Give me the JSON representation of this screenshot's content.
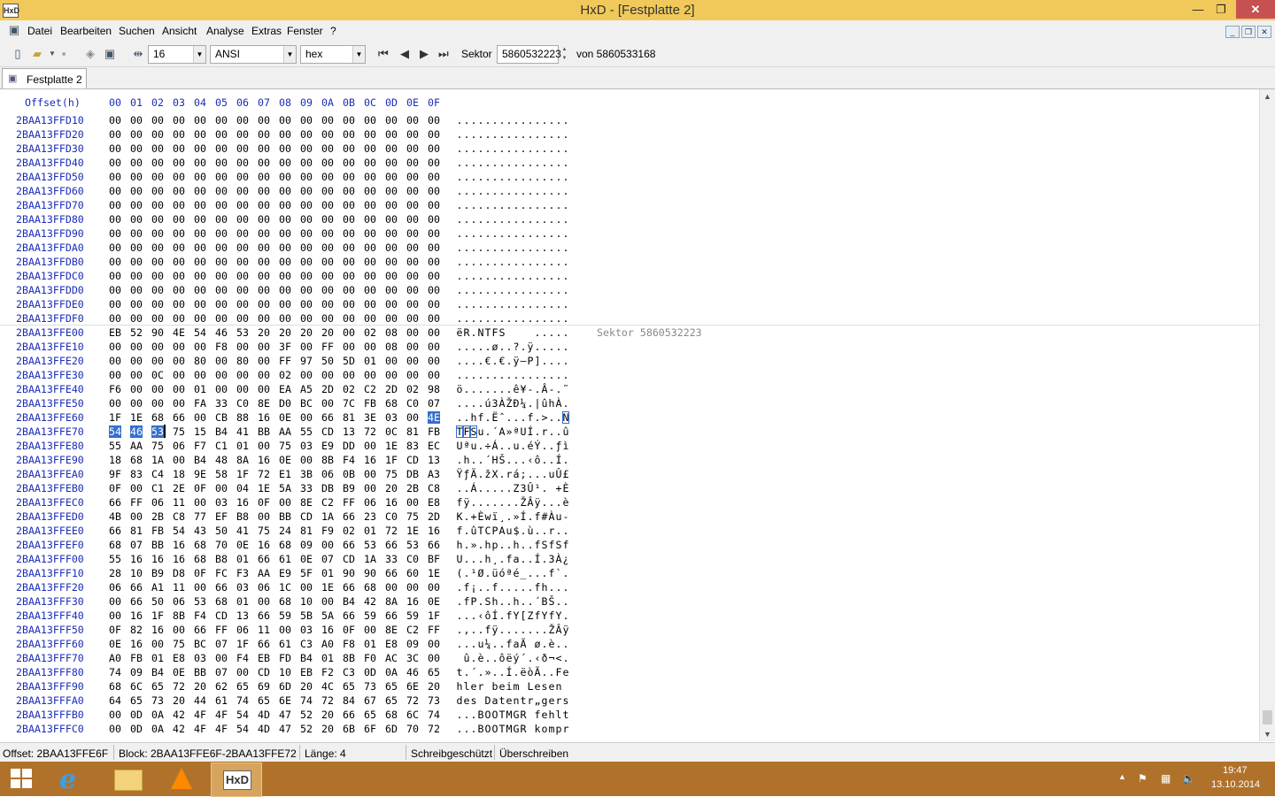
{
  "window": {
    "title": "HxD - [Festplatte 2]",
    "icon_text": "HxD"
  },
  "menu": [
    "Datei",
    "Bearbeiten",
    "Suchen",
    "Ansicht",
    "Analyse",
    "Extras",
    "Fenster",
    "?"
  ],
  "toolbar": {
    "bytes_per_row": "16",
    "charset": "ANSI",
    "offset_base": "hex",
    "sektor_label": "Sektor",
    "sektor_value": "5860532223",
    "sektor_total": "von 5860533168"
  },
  "tab": {
    "label": "Festplatte 2"
  },
  "editor": {
    "offset_header": "Offset(h)",
    "col_headers": [
      "00",
      "01",
      "02",
      "03",
      "04",
      "05",
      "06",
      "07",
      "08",
      "09",
      "0A",
      "0B",
      "0C",
      "0D",
      "0E",
      "0F"
    ],
    "sector_note": "Sektor 5860532223",
    "rows": [
      {
        "o": "2BAA13FFD10",
        "h": "00 00 00 00 00 00 00 00 00 00 00 00 00 00 00 00",
        "a": "................"
      },
      {
        "o": "2BAA13FFD20",
        "h": "00 00 00 00 00 00 00 00 00 00 00 00 00 00 00 00",
        "a": "................"
      },
      {
        "o": "2BAA13FFD30",
        "h": "00 00 00 00 00 00 00 00 00 00 00 00 00 00 00 00",
        "a": "................"
      },
      {
        "o": "2BAA13FFD40",
        "h": "00 00 00 00 00 00 00 00 00 00 00 00 00 00 00 00",
        "a": "................"
      },
      {
        "o": "2BAA13FFD50",
        "h": "00 00 00 00 00 00 00 00 00 00 00 00 00 00 00 00",
        "a": "................"
      },
      {
        "o": "2BAA13FFD60",
        "h": "00 00 00 00 00 00 00 00 00 00 00 00 00 00 00 00",
        "a": "................"
      },
      {
        "o": "2BAA13FFD70",
        "h": "00 00 00 00 00 00 00 00 00 00 00 00 00 00 00 00",
        "a": "................"
      },
      {
        "o": "2BAA13FFD80",
        "h": "00 00 00 00 00 00 00 00 00 00 00 00 00 00 00 00",
        "a": "................"
      },
      {
        "o": "2BAA13FFD90",
        "h": "00 00 00 00 00 00 00 00 00 00 00 00 00 00 00 00",
        "a": "................"
      },
      {
        "o": "2BAA13FFDA0",
        "h": "00 00 00 00 00 00 00 00 00 00 00 00 00 00 00 00",
        "a": "................"
      },
      {
        "o": "2BAA13FFDB0",
        "h": "00 00 00 00 00 00 00 00 00 00 00 00 00 00 00 00",
        "a": "................"
      },
      {
        "o": "2BAA13FFDC0",
        "h": "00 00 00 00 00 00 00 00 00 00 00 00 00 00 00 00",
        "a": "................"
      },
      {
        "o": "2BAA13FFDD0",
        "h": "00 00 00 00 00 00 00 00 00 00 00 00 00 00 00 00",
        "a": "................"
      },
      {
        "o": "2BAA13FFDE0",
        "h": "00 00 00 00 00 00 00 00 00 00 00 00 00 00 00 00",
        "a": "................"
      },
      {
        "o": "2BAA13FFDF0",
        "h": "00 00 00 00 00 00 00 00 00 00 00 00 00 00 00 00",
        "a": "................"
      },
      {
        "o": "2BAA13FFE00",
        "h": "EB 52 90 4E 54 46 53 20 20 20 20 00 02 08 00 00",
        "a": "ëR.NTFS    ....."
      },
      {
        "o": "2BAA13FFE10",
        "h": "00 00 00 00 00 F8 00 00 3F 00 FF 00 00 08 00 00",
        "a": ".....ø..?.ÿ....."
      },
      {
        "o": "2BAA13FFE20",
        "h": "00 00 00 00 80 00 80 00 FF 97 50 5D 01 00 00 00",
        "a": "....€.€.ÿ—P]...."
      },
      {
        "o": "2BAA13FFE30",
        "h": "00 00 0C 00 00 00 00 00 02 00 00 00 00 00 00 00",
        "a": "................"
      },
      {
        "o": "2BAA13FFE40",
        "h": "F6 00 00 00 01 00 00 00 EA A5 2D 02 C2 2D 02 98",
        "a": "ö.......ê¥-.Â-.˜"
      },
      {
        "o": "2BAA13FFE50",
        "h": "00 00 00 00 FA 33 C0 8E D0 BC 00 7C FB 68 C0 07",
        "a": "....ú3ÀŽÐ¼.|ûhÀ."
      },
      {
        "o": "2BAA13FFE60",
        "h": "1F 1E 68 66 00 CB 88 16 0E 00 66 81 3E 03 00 4E",
        "a": "..hf.Ëˆ...f.>..N"
      },
      {
        "o": "2BAA13FFE70",
        "h": "54 46 53 75 15 B4 41 BB AA 55 CD 13 72 0C 81 FB",
        "a": "TFSu.´A»ªUÍ.r..û"
      },
      {
        "o": "2BAA13FFE80",
        "h": "55 AA 75 06 F7 C1 01 00 75 03 E9 DD 00 1E 83 EC",
        "a": "Uªu.÷Á..u.éÝ..ƒì"
      },
      {
        "o": "2BAA13FFE90",
        "h": "18 68 1A 00 B4 48 8A 16 0E 00 8B F4 16 1F CD 13",
        "a": ".h..´HŠ...‹ô..Í."
      },
      {
        "o": "2BAA13FFEA0",
        "h": "9F 83 C4 18 9E 58 1F 72 E1 3B 06 0B 00 75 DB A3",
        "a": "ŸƒÄ.žX.rá;...uÛ£"
      },
      {
        "o": "2BAA13FFEB0",
        "h": "0F 00 C1 2E 0F 00 04 1E 5A 33 DB B9 00 20 2B C8",
        "a": "..Á.....Z3Û¹. +È"
      },
      {
        "o": "2BAA13FFEC0",
        "h": "66 FF 06 11 00 03 16 0F 00 8E C2 FF 06 16 00 E8",
        "a": "fÿ.......ŽÂÿ...è"
      },
      {
        "o": "2BAA13FFED0",
        "h": "4B 00 2B C8 77 EF B8 00 BB CD 1A 66 23 C0 75 2D",
        "a": "K.+Èwï¸.»Í.f#Àu-"
      },
      {
        "o": "2BAA13FFEE0",
        "h": "66 81 FB 54 43 50 41 75 24 81 F9 02 01 72 1E 16",
        "a": "f.ûTCPAu$.ù..r.."
      },
      {
        "o": "2BAA13FFEF0",
        "h": "68 07 BB 16 68 70 0E 16 68 09 00 66 53 66 53 66",
        "a": "h.».hp..h..fSfSf"
      },
      {
        "o": "2BAA13FFF00",
        "h": "55 16 16 16 68 B8 01 66 61 0E 07 CD 1A 33 C0 BF",
        "a": "U...h¸.fa..Í.3À¿"
      },
      {
        "o": "2BAA13FFF10",
        "h": "28 10 B9 D8 0F FC F3 AA E9 5F 01 90 90 66 60 1E",
        "a": "(.¹Ø.üóªé_...f`."
      },
      {
        "o": "2BAA13FFF20",
        "h": "06 66 A1 11 00 66 03 06 1C 00 1E 66 68 00 00 00",
        "a": ".f¡..f.....fh..."
      },
      {
        "o": "2BAA13FFF30",
        "h": "00 66 50 06 53 68 01 00 68 10 00 B4 42 8A 16 0E",
        "a": ".fP.Sh..h..´BŠ.."
      },
      {
        "o": "2BAA13FFF40",
        "h": "00 16 1F 8B F4 CD 13 66 59 5B 5A 66 59 66 59 1F",
        "a": "...‹ôÍ.fY[ZfYfY."
      },
      {
        "o": "2BAA13FFF50",
        "h": "0F 82 16 00 66 FF 06 11 00 03 16 0F 00 8E C2 FF",
        "a": ".‚..fÿ.......ŽÂÿ"
      },
      {
        "o": "2BAA13FFF60",
        "h": "0E 16 00 75 BC 07 1F 66 61 C3 A0 F8 01 E8 09 00",
        "a": "...u¼..faÃ ø.è.."
      },
      {
        "o": "2BAA13FFF70",
        "h": "A0 FB 01 E8 03 00 F4 EB FD B4 01 8B F0 AC 3C 00",
        "a": " û.è..ôëý´.‹ð¬<."
      },
      {
        "o": "2BAA13FFF80",
        "h": "74 09 B4 0E BB 07 00 CD 10 EB F2 C3 0D 0A 46 65",
        "a": "t.´.»..Í.ëòÃ..Fe"
      },
      {
        "o": "2BAA13FFF90",
        "h": "68 6C 65 72 20 62 65 69 6D 20 4C 65 73 65 6E 20",
        "a": "hler beim Lesen "
      },
      {
        "o": "2BAA13FFFA0",
        "h": "64 65 73 20 44 61 74 65 6E 74 72 84 67 65 72 73",
        "a": "des Datentr„gers"
      },
      {
        "o": "2BAA13FFFB0",
        "h": "00 0D 0A 42 4F 4F 54 4D 47 52 20 66 65 68 6C 74",
        "a": "...BOOTMGR fehlt"
      },
      {
        "o": "2BAA13FFFC0",
        "h": "00 0D 0A 42 4F 4F 54 4D 47 52 20 6B 6F 6D 70 72",
        "a": "...BOOTMGR kompr"
      }
    ]
  },
  "status": {
    "offset": "Offset: 2BAA13FFE6F",
    "block": "Block: 2BAA13FFE6F-2BAA13FFE72",
    "length": "Länge: 4",
    "protect": "Schreibgeschützt",
    "mode": "Überschreiben"
  },
  "taskbar": {
    "time": "19:47",
    "date": "13.10.2014",
    "hxd_label": "HxD"
  },
  "colors": {
    "titlebar": "#f1c95b",
    "taskbar": "#b0722a",
    "offset_blue": "#1a2cb8",
    "selection": "#3370d0"
  }
}
